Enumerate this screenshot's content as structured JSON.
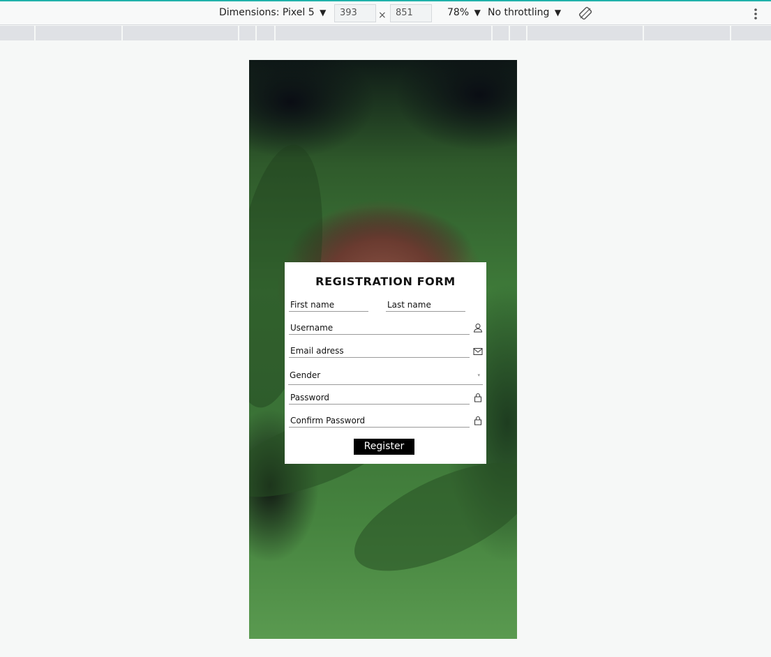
{
  "toolbar": {
    "dimensions_label": "Dimensions: Pixel 5",
    "width": "393",
    "height": "851",
    "times": "×",
    "zoom": "78%",
    "throttling": "No throttling",
    "dropdown_arrow": "▼",
    "rotate_icon": "rotate-icon",
    "more_icon": "more-vert-icon"
  },
  "form": {
    "title": "REGISTRATION FORM",
    "first_name": "First name",
    "last_name": "Last name",
    "username": "Username",
    "email": "Email adress",
    "gender": "Gender",
    "password": "Password",
    "confirm_password": "Confirm Password",
    "register": "Register"
  },
  "colors": {
    "accent": "#20b2aa",
    "button_bg": "#000000",
    "card_bg": "#ffffff"
  }
}
